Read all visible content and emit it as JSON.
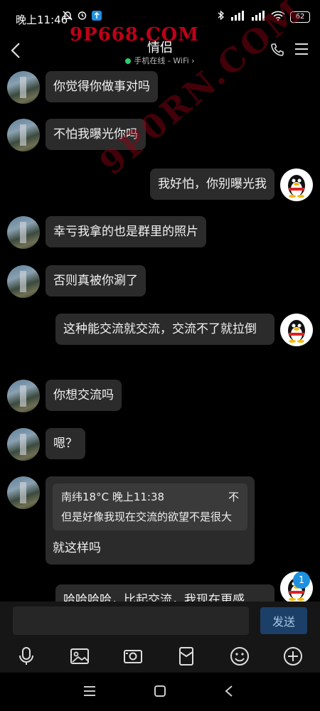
{
  "status_bar": {
    "time": "晚上11:46",
    "battery": "62"
  },
  "watermark": {
    "top": "9P668.COM",
    "diagonal": "9P0RN.COM"
  },
  "header": {
    "title": "情侣",
    "status": "手机在线 - WiFi"
  },
  "messages": [
    {
      "side": "left",
      "text": "你觉得你做事对吗"
    },
    {
      "side": "left",
      "text": "不怕我曝光你吗"
    },
    {
      "side": "right",
      "text": "我好怕，你别曝光我"
    },
    {
      "side": "left",
      "text": "幸亏我拿的也是群里的照片"
    },
    {
      "side": "left",
      "text": "否则真被你涮了"
    },
    {
      "side": "right",
      "text": "这种能交流就交流，交流不了就拉倒"
    },
    {
      "side": "left",
      "text": "你想交流吗"
    },
    {
      "side": "left",
      "text": "嗯？"
    },
    {
      "side": "left",
      "text": "就这样吗",
      "quote": {
        "sender": "南纬18°C",
        "time": "晚上11:38",
        "flag": "不",
        "text": "但是好像我现在交流的欲望不是很大"
      }
    },
    {
      "side": "right",
      "text": "哈哈哈哈，比起交流，我现在更感"
    }
  ],
  "unread_badge": "1",
  "input": {
    "value": "",
    "send_label": "发送"
  },
  "toolbar": [
    "microphone-icon",
    "image-icon",
    "camera-icon",
    "red-packet-icon",
    "emoji-icon",
    "plus-icon"
  ],
  "nav": [
    "menu-icon",
    "home-icon",
    "back-icon"
  ]
}
